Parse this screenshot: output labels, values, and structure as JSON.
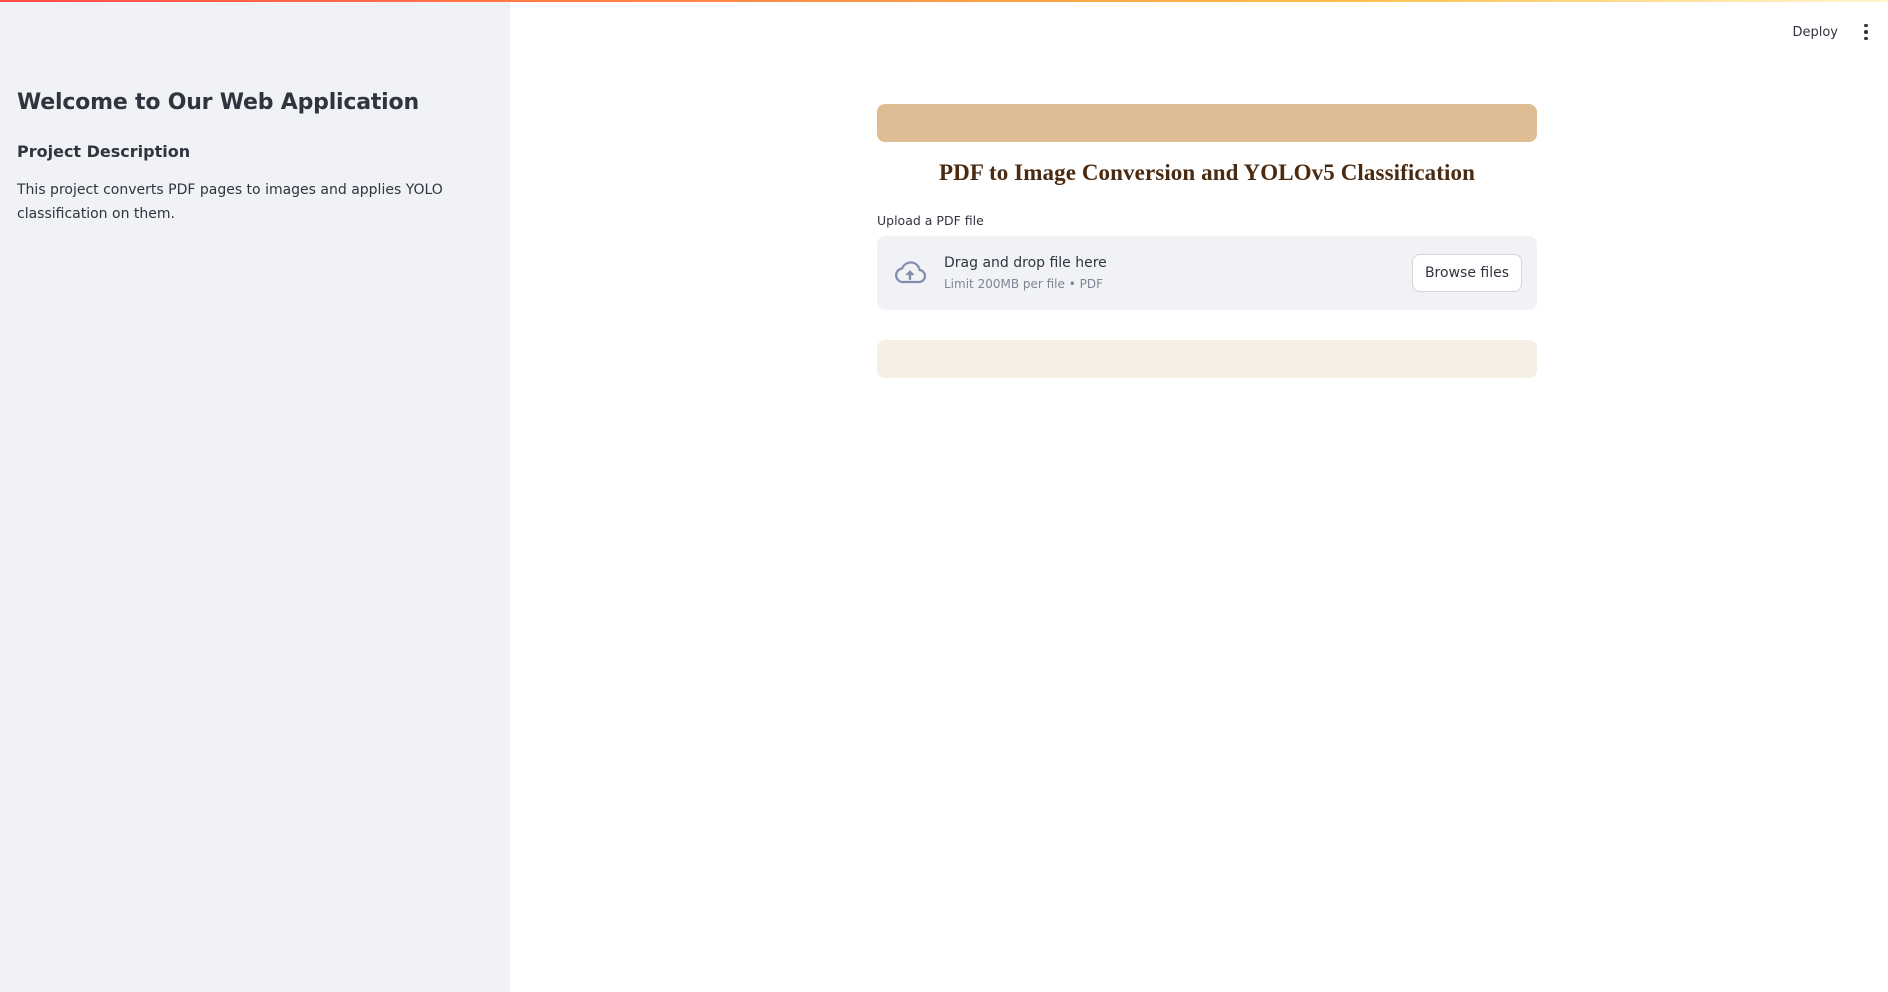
{
  "colors": {
    "sidebar_bg": "#f0f2f6",
    "banner": "#dfbd94",
    "title_text": "#4a2a10",
    "info_bar": "#f5efe4",
    "dropzone_bg": "#f0f2f6"
  },
  "header": {
    "deploy_label": "Deploy",
    "menu_icon": "vertical-dots-icon"
  },
  "sidebar": {
    "title": "Welcome to Our Web Application",
    "subtitle": "Project Description",
    "description": "This project converts PDF pages to images and applies YOLO classification on them."
  },
  "main": {
    "title": "PDF to Image Conversion and YOLOv5 Classification",
    "upload": {
      "label": "Upload a PDF file",
      "drop_text": "Drag and drop file here",
      "limit_text": "Limit 200MB per file • PDF",
      "browse_label": "Browse files",
      "icon": "cloud-upload-icon"
    }
  }
}
